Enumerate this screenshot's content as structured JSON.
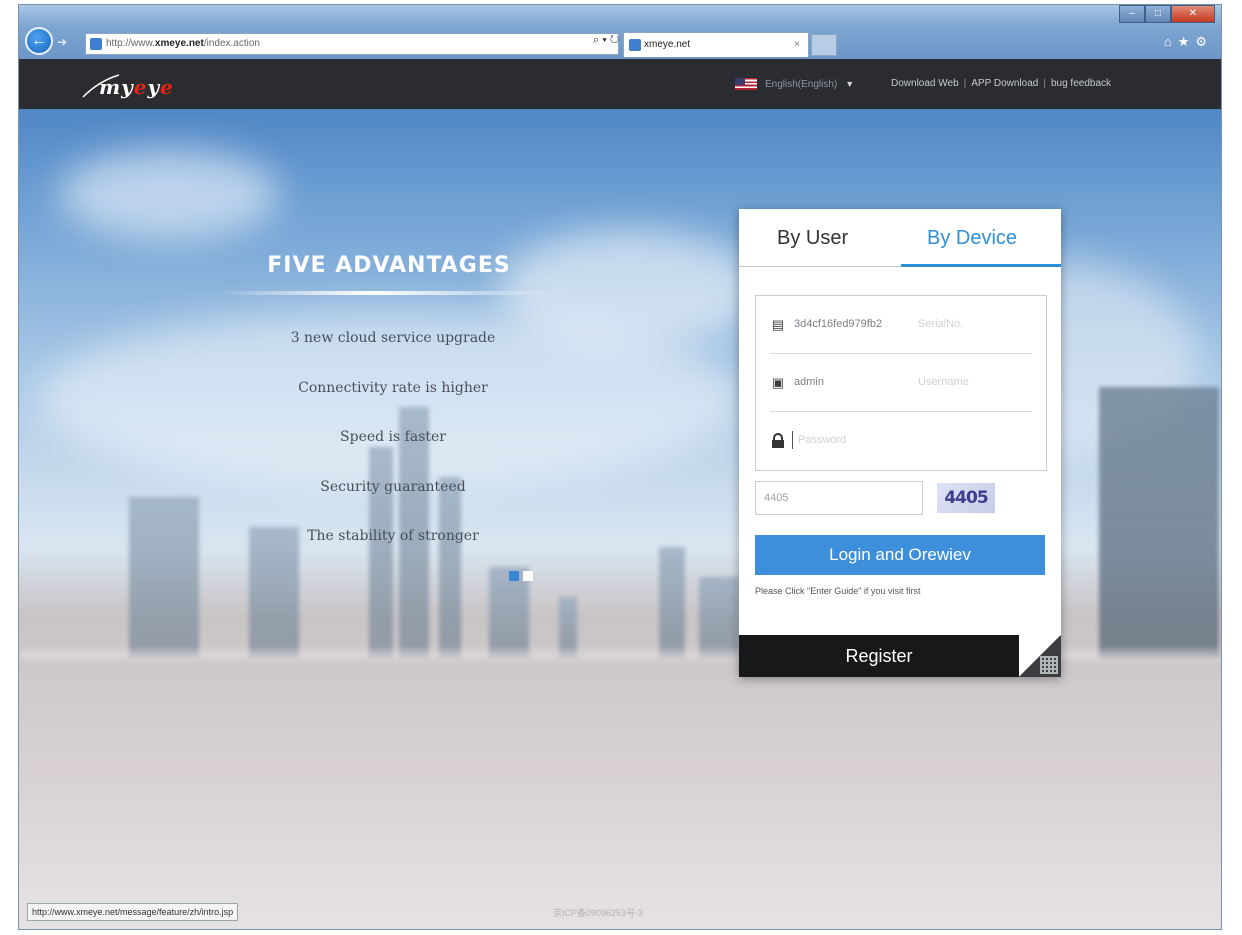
{
  "browser": {
    "address": "http://www.xmeye.net/index.action",
    "address_prefix": "http://www.",
    "address_domain": "xmeye.net",
    "address_path": "/index.action",
    "address_tools": "⌕ ▾ ↻",
    "tab_title": "xmeye.net",
    "tab_close": "×",
    "status_url": "http://www.xmeye.net/message/feature/zh/intro.jsp"
  },
  "header": {
    "language": "English(English)",
    "links": [
      "Download Web",
      "APP Download",
      "bug feedback"
    ],
    "separator": "|"
  },
  "advantages": {
    "title": "FIVE ADVANTAGES",
    "items": [
      "3 new cloud service upgrade",
      "Connectivity rate is higher",
      "Speed is faster",
      "Security guaranteed",
      "The stability of stronger"
    ]
  },
  "login": {
    "tabs": [
      "By User",
      "By Device"
    ],
    "active_tab": "By Device",
    "serial_value": "3d4cf16fed979fb2",
    "serial_placeholder": "SerialNo.",
    "username_value": "admin",
    "username_placeholder": "Username",
    "password_placeholder": "Password",
    "captcha_value": "4405",
    "captcha_image_text": "4405",
    "login_button": "Login and Orewiev",
    "hint": "Please Click \"Enter Guide\" if you visit first",
    "register_button": "Register"
  },
  "footer": {
    "icp": "京ICP备09096253号-3"
  },
  "icons": [
    "back-arrow-icon",
    "forward-arrow-icon",
    "search-icon",
    "refresh-icon",
    "home-icon",
    "star-icon",
    "gear-icon",
    "flag-us-icon",
    "serial-card-icon",
    "monitor-user-icon",
    "lock-icon",
    "qr-code-icon"
  ],
  "colors": {
    "accent": "#3d8fdc",
    "topbar": "#2a2c2f",
    "register": "#171819",
    "logo_red": "#e2231a"
  }
}
